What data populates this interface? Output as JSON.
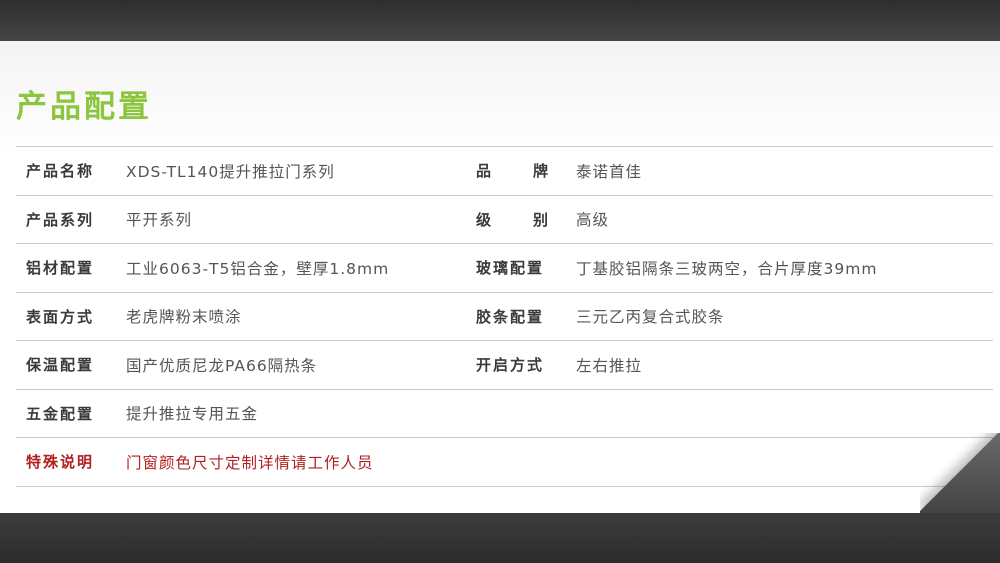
{
  "colors": {
    "accent": "#8cc63e",
    "special": "#b21f1f"
  },
  "title": "产品配置",
  "rows": [
    {
      "left": {
        "label": "产品名称",
        "value": "XDS-TL140提升推拉门系列"
      },
      "right": {
        "label": "品 牌",
        "value": "泰诺首佳"
      }
    },
    {
      "left": {
        "label": "产品系列",
        "value": "平开系列"
      },
      "right": {
        "label": "级 别",
        "value": "高级"
      }
    },
    {
      "left": {
        "label": "铝材配置",
        "value": "工业6063-T5铝合金，壁厚1.8mm"
      },
      "right": {
        "label": "玻璃配置",
        "value": "丁基胶铝隔条三玻两空，合片厚度39mm"
      }
    },
    {
      "left": {
        "label": "表面方式",
        "value": "老虎牌粉末喷涂"
      },
      "right": {
        "label": "胶条配置",
        "value": "三元乙丙复合式胶条"
      }
    },
    {
      "left": {
        "label": "保温配置",
        "value": "国产优质尼龙PA66隔热条"
      },
      "right": {
        "label": "开启方式",
        "value": "左右推拉"
      }
    },
    {
      "left": {
        "label": "五金配置",
        "value": "提升推拉专用五金"
      }
    },
    {
      "left": {
        "label": "特殊说明",
        "value": "门窗颜色尺寸定制详情请工作人员"
      }
    }
  ]
}
